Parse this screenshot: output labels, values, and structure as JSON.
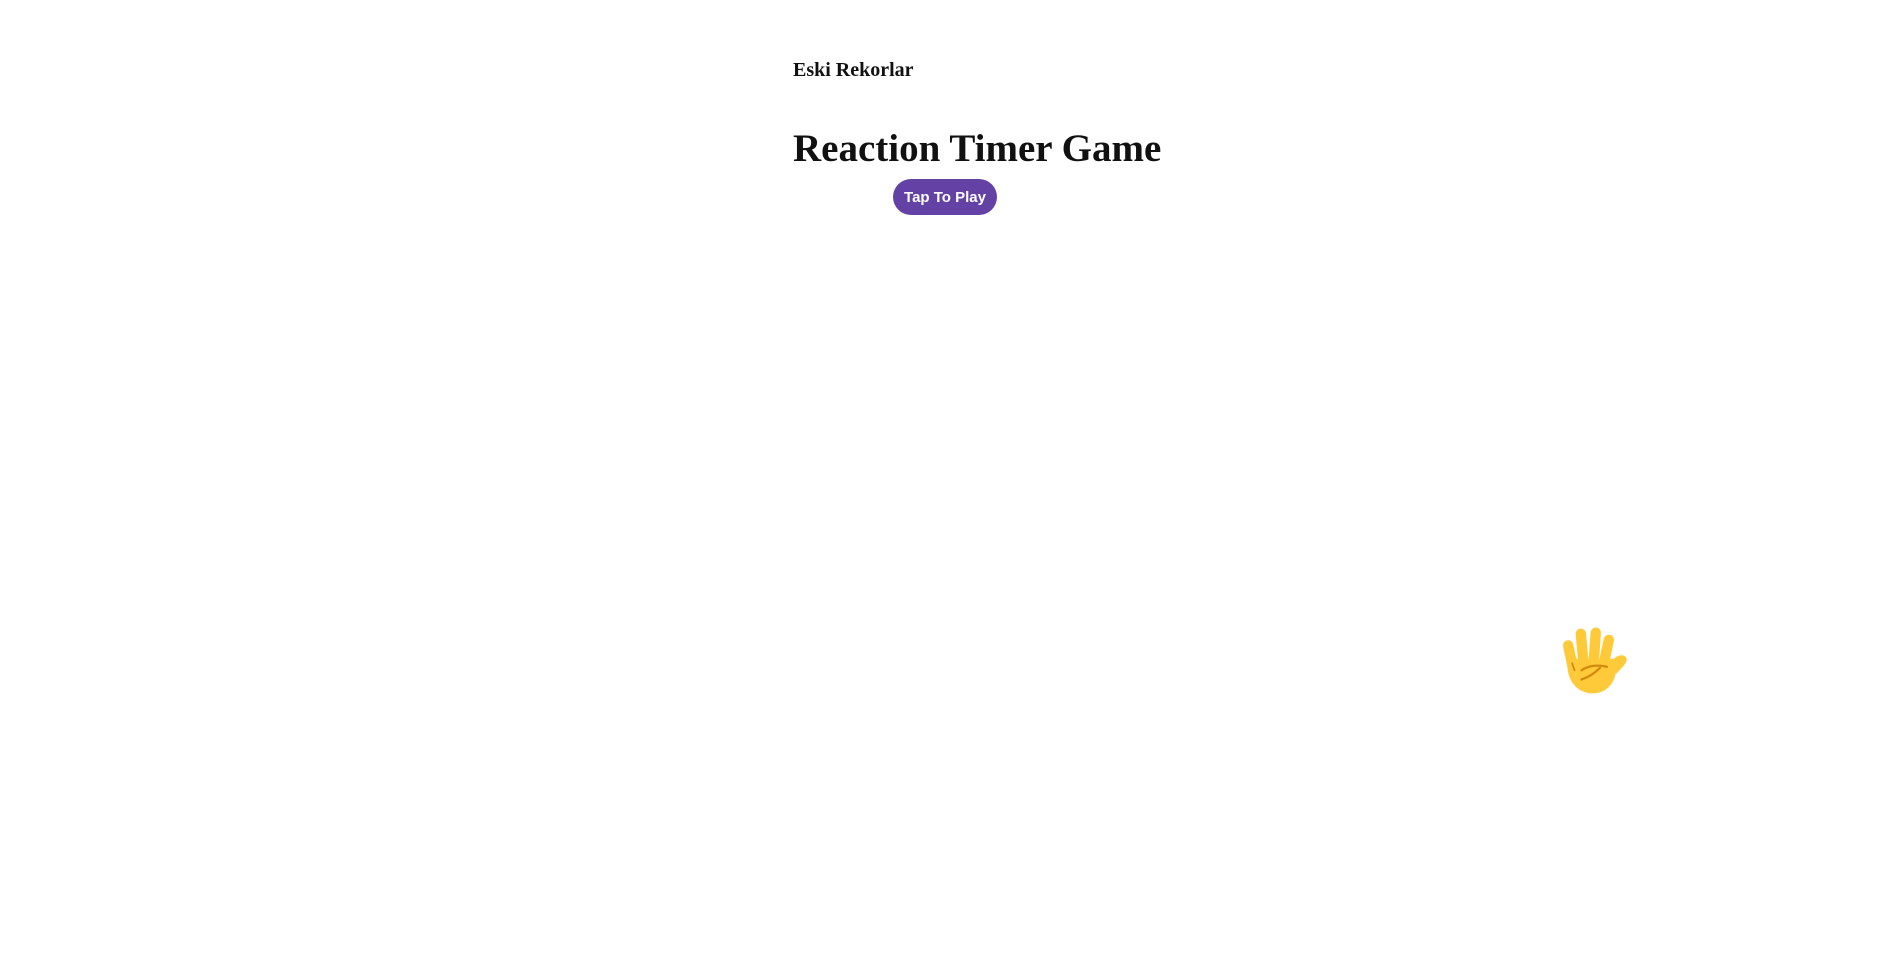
{
  "records": {
    "title": "Eski Rekorlar"
  },
  "game": {
    "title": "Reaction Timer Game",
    "play_button_label": "Tap To Play"
  },
  "icons": {
    "hand": "raised-hand-with-fingers-splayed-icon"
  },
  "colors": {
    "button_bg": "#6441a5",
    "button_text": "#ffffff",
    "hand_fill": "#FFCA3A",
    "hand_line": "#D48A0E"
  }
}
